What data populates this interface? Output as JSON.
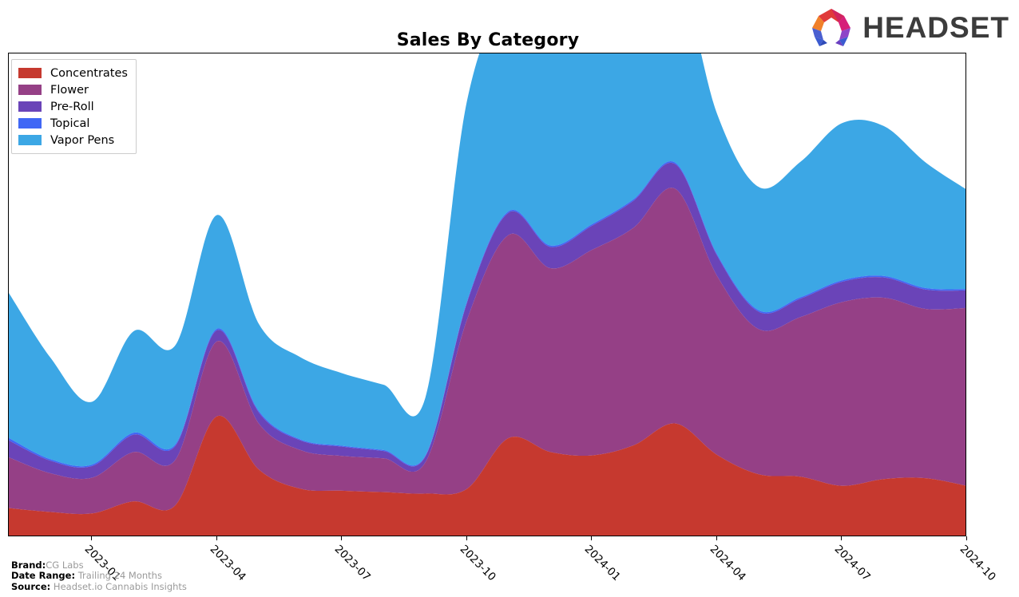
{
  "header": {
    "title": "Sales By Category",
    "logo": {
      "name": "headset-logo",
      "wordmark": "HEADSET",
      "mark_colors": [
        "#f0802a",
        "#e03a3a",
        "#d61f7a",
        "#8e44c8",
        "#4a5fd0",
        "#3b5bd0"
      ],
      "word_color": "#3c3c3c"
    }
  },
  "legend": {
    "position": "top-left",
    "items": [
      {
        "label": "Concentrates",
        "color": "#c6392f"
      },
      {
        "label": "Flower",
        "color": "#954086"
      },
      {
        "label": "Pre-Roll",
        "color": "#6a44b8"
      },
      {
        "label": "Topical",
        "color": "#4067f5"
      },
      {
        "label": "Vapor Pens",
        "color": "#3ca7e5"
      }
    ]
  },
  "axis": {
    "x_ticks": [
      "2023-01",
      "2023-04",
      "2023-07",
      "2023-10",
      "2024-01",
      "2024-04",
      "2024-07",
      "2024-10"
    ],
    "y_ticks": [],
    "y_visible": false,
    "grid": false
  },
  "footnotes": [
    {
      "label": "Brand:",
      "value": "CG Labs"
    },
    {
      "label": "Date Range:",
      "value": "Trailing 24 Months"
    },
    {
      "label": "Source:",
      "value": "Headset.io Cannabis Insights"
    }
  ],
  "chart_data": {
    "type": "area",
    "stacked": true,
    "smoothing": "spline",
    "title": "Sales By Category",
    "xlabel": "",
    "ylabel": "",
    "grid": false,
    "legend_position": "top-left",
    "x": [
      "2022-11",
      "2022-12",
      "2023-01",
      "2023-02",
      "2023-03",
      "2023-04",
      "2023-05",
      "2023-06",
      "2023-07",
      "2023-08",
      "2023-09",
      "2023-10",
      "2023-11",
      "2023-12",
      "2024-01",
      "2024-02",
      "2024-03",
      "2024-04",
      "2024-05",
      "2024-06",
      "2024-07",
      "2024-08",
      "2024-09",
      "2024-10"
    ],
    "xlim": [
      "2022-11",
      "2024-10"
    ],
    "ylim": [
      0,
      100
    ],
    "series": [
      {
        "name": "Concentrates",
        "color": "#c6392f",
        "values": [
          6.0,
          5.2,
          4.9,
          7.4,
          6.6,
          25.0,
          14.0,
          10.0,
          9.6,
          9.3,
          9.0,
          10.0,
          20.5,
          17.6,
          16.9,
          19.0,
          23.5,
          17.0,
          13.0,
          12.5,
          10.6,
          12.0,
          12.2,
          10.6
        ]
      },
      {
        "name": "Flower",
        "color": "#954086",
        "values": [
          10.5,
          8.0,
          7.4,
          10.2,
          9.4,
          15.5,
          9.5,
          8.0,
          7.2,
          7.0,
          6.5,
          35.0,
          42.0,
          38.0,
          42.5,
          45.0,
          48.5,
          37.0,
          30.0,
          33.0,
          38.0,
          37.5,
          35.0,
          36.8
        ]
      },
      {
        "name": "Pre-Roll",
        "color": "#6a44b8",
        "values": [
          3.5,
          2.6,
          2.4,
          3.6,
          2.9,
          2.3,
          2.3,
          2.0,
          1.9,
          1.5,
          1.2,
          3.5,
          4.6,
          4.4,
          5.0,
          5.6,
          5.1,
          4.2,
          3.6,
          3.8,
          4.2,
          4.2,
          4.0,
          3.6
        ]
      },
      {
        "name": "Topical",
        "color": "#4067f5",
        "values": [
          0.5,
          0.3,
          0.3,
          0.4,
          0.3,
          0.3,
          0.3,
          0.2,
          0.2,
          0.2,
          0.2,
          0.3,
          0.3,
          0.3,
          0.3,
          0.3,
          0.3,
          0.3,
          0.3,
          0.3,
          0.3,
          0.3,
          0.3,
          0.3
        ]
      },
      {
        "name": "Vapor Pens",
        "color": "#3ca7e5",
        "values": [
          30.0,
          21.0,
          13.0,
          21.0,
          20.5,
          23.5,
          18.0,
          17.0,
          15.0,
          13.5,
          12.0,
          41.5,
          42.5,
          40.0,
          39.0,
          36.0,
          40.5,
          29.0,
          25.5,
          28.0,
          32.5,
          31.0,
          26.0,
          20.5
        ]
      }
    ]
  }
}
